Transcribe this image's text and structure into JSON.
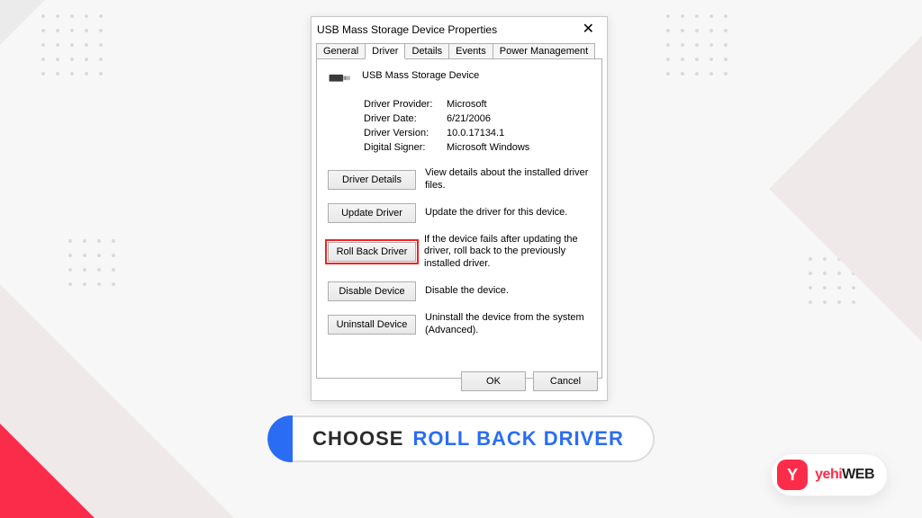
{
  "dialog": {
    "title": "USB Mass Storage Device Properties",
    "close_glyph": "✕",
    "tabs": {
      "general": "General",
      "driver": "Driver",
      "details": "Details",
      "events": "Events",
      "power": "Power Management"
    },
    "device_name": "USB Mass Storage Device",
    "info": {
      "provider_label": "Driver Provider:",
      "provider_value": "Microsoft",
      "date_label": "Driver Date:",
      "date_value": "6/21/2006",
      "version_label": "Driver Version:",
      "version_value": "10.0.17134.1",
      "signer_label": "Digital Signer:",
      "signer_value": "Microsoft Windows"
    },
    "actions": {
      "details_label": "Driver Details",
      "details_desc": "View details about the installed driver files.",
      "update_label": "Update Driver",
      "update_desc": "Update the driver for this device.",
      "rollback_label": "Roll Back Driver",
      "rollback_desc": "If the device fails after updating the driver, roll back to the previously installed driver.",
      "disable_label": "Disable Device",
      "disable_desc": "Disable the device.",
      "uninstall_label": "Uninstall Device",
      "uninstall_desc": "Uninstall the device from the system (Advanced)."
    },
    "footer": {
      "ok": "OK",
      "cancel": "Cancel"
    }
  },
  "caption": {
    "prefix": "CHOOSE",
    "highlight": "ROLL BACK DRIVER"
  },
  "logo": {
    "mark": "Y",
    "part1": "yehi",
    "part2": "WEB"
  }
}
